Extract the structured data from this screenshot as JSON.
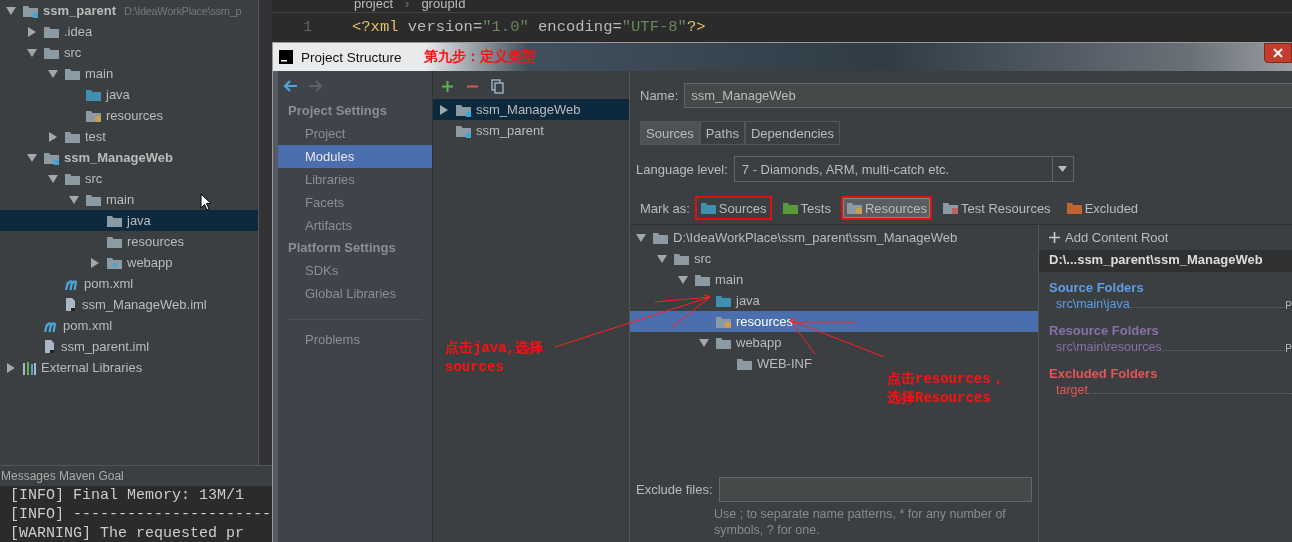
{
  "project_tree": [
    {
      "name": "ssm_parent",
      "path": "D:\\IdeaWorkPlace\\ssm_p",
      "kind": "module",
      "bold": true,
      "expanded": true,
      "selected": false,
      "children": [
        {
          "name": ".idea",
          "kind": "folder",
          "expanded": false,
          "selected": false
        },
        {
          "name": "src",
          "kind": "folder",
          "expanded": true,
          "selected": false,
          "children": [
            {
              "name": "main",
              "kind": "folder",
              "expanded": true,
              "selected": false,
              "children": [
                {
                  "name": "java",
                  "kind": "source",
                  "selected": false
                },
                {
                  "name": "resources",
                  "kind": "resource",
                  "selected": false
                }
              ]
            },
            {
              "name": "test",
              "kind": "folder",
              "expanded": false,
              "selected": false
            }
          ]
        },
        {
          "name": "ssm_ManageWeb",
          "kind": "module",
          "bold": true,
          "expanded": true,
          "selected": false,
          "children": [
            {
              "name": "src",
              "kind": "folder",
              "expanded": true,
              "selected": false,
              "children": [
                {
                  "name": "main",
                  "kind": "folder",
                  "expanded": true,
                  "selected": false,
                  "children": [
                    {
                      "name": "java",
                      "kind": "folder",
                      "selected": true
                    },
                    {
                      "name": "resources",
                      "kind": "folder",
                      "selected": false
                    },
                    {
                      "name": "webapp",
                      "kind": "web",
                      "expanded": false,
                      "selected": false
                    }
                  ]
                }
              ]
            },
            {
              "name": "pom.xml",
              "kind": "maven",
              "selected": false
            },
            {
              "name": "ssm_ManageWeb.iml",
              "kind": "iml",
              "selected": false
            }
          ]
        },
        {
          "name": "pom.xml",
          "kind": "maven",
          "selected": false
        },
        {
          "name": "ssm_parent.iml",
          "kind": "iml",
          "selected": false
        }
      ]
    },
    {
      "name": "External Libraries",
      "kind": "libraries",
      "expanded": false,
      "selected": false
    }
  ],
  "editor": {
    "breadcrumb": [
      "project",
      "groupId"
    ],
    "breadcrumb_separator": "›",
    "lines": [
      {
        "number": "1",
        "tokens": [
          {
            "text": "<?xml ",
            "kind": "tag"
          },
          {
            "text": "version=",
            "kind": "attr"
          },
          {
            "text": "\"1.0\"",
            "kind": "string"
          },
          {
            "text": " encoding=",
            "kind": "attr"
          },
          {
            "text": "\"UTF-8\"",
            "kind": "string"
          },
          {
            "text": "?>",
            "kind": "tag"
          }
        ]
      }
    ]
  },
  "messages": {
    "title": "Messages Maven Goal",
    "lines": [
      "[INFO] Final Memory: 13M/1",
      "[INFO] ----------------------",
      "[WARNING] The requested pr"
    ]
  },
  "dialog": {
    "title": "Project Structure",
    "title_note": "第九步：定义类型",
    "nav": [
      {
        "heading": "Project Settings",
        "items": [
          {
            "label": "Project",
            "selected": false
          },
          {
            "label": "Modules",
            "selected": true
          },
          {
            "label": "Libraries",
            "selected": false
          },
          {
            "label": "Facets",
            "selected": false
          },
          {
            "label": "Artifacts",
            "selected": false
          }
        ]
      },
      {
        "heading": "Platform Settings",
        "items": [
          {
            "label": "SDKs",
            "selected": false
          },
          {
            "label": "Global Libraries",
            "selected": false
          }
        ]
      },
      {
        "items": [
          {
            "label": "Problems",
            "selected": false
          }
        ]
      }
    ],
    "modules": [
      {
        "name": "ssm_ManageWeb",
        "expanded": false,
        "selected": true
      },
      {
        "name": "ssm_parent",
        "selected": false
      }
    ],
    "name": {
      "label": "Name:",
      "value": "ssm_ManageWeb"
    },
    "tabs": [
      {
        "label": "Sources",
        "selected": true
      },
      {
        "label": "Paths",
        "selected": false
      },
      {
        "label": "Dependencies",
        "selected": false
      }
    ],
    "language_level": {
      "label": "Language level:",
      "value": "7 - Diamonds, ARM, multi-catch etc."
    },
    "mark_as": {
      "label": "Mark as:",
      "options": [
        {
          "label": "Sources",
          "kind": "source",
          "pressed": false,
          "highlighted": true
        },
        {
          "label": "Tests",
          "kind": "test",
          "pressed": false,
          "highlighted": false
        },
        {
          "label": "Resources",
          "kind": "resource",
          "pressed": true,
          "highlighted": true
        },
        {
          "label": "Test Resources",
          "kind": "test-resource",
          "pressed": false,
          "highlighted": false
        },
        {
          "label": "Excluded",
          "kind": "excluded",
          "pressed": false,
          "highlighted": false
        }
      ]
    },
    "content_tree": [
      {
        "name": "D:\\IdeaWorkPlace\\ssm_parent\\ssm_ManageWeb",
        "kind": "folder",
        "expanded": true,
        "selected": false,
        "children": [
          {
            "name": "src",
            "kind": "folder",
            "expanded": true,
            "selected": false,
            "children": [
              {
                "name": "main",
                "kind": "folder",
                "expanded": true,
                "selected": false,
                "children": [
                  {
                    "name": "java",
                    "kind": "source",
                    "selected": false
                  },
                  {
                    "name": "resources",
                    "kind": "resource",
                    "selected": true
                  },
                  {
                    "name": "webapp",
                    "kind": "folder",
                    "expanded": true,
                    "selected": false,
                    "children": [
                      {
                        "name": "WEB-INF",
                        "kind": "folder",
                        "selected": false
                      }
                    ]
                  }
                ]
              }
            ]
          }
        ]
      }
    ],
    "content_root": {
      "add_label": "Add Content Root",
      "root": "D:\\...ssm_parent\\ssm_ManageWeb",
      "groups": [
        {
          "title": "Source Folders",
          "color": "#5e9ee8",
          "entries": [
            {
              "path": "src\\main\\java",
              "suffix": "P"
            }
          ]
        },
        {
          "title": "Resource Folders",
          "color": "#8a6fa8",
          "entries": [
            {
              "path": "src\\main\\resources",
              "suffix": "P"
            }
          ]
        },
        {
          "title": "Excluded Folders",
          "color": "#e25656",
          "entries": [
            {
              "path": "target"
            }
          ]
        }
      ]
    },
    "exclude_files": {
      "label": "Exclude files:",
      "hint": "Use ; to separate name patterns, * for any number of symbols, ? for one."
    },
    "notes": [
      {
        "lines": [
          "点击java,选择",
          "sources"
        ]
      },
      {
        "lines": [
          "点击resources，",
          "选择Resources"
        ]
      }
    ]
  }
}
